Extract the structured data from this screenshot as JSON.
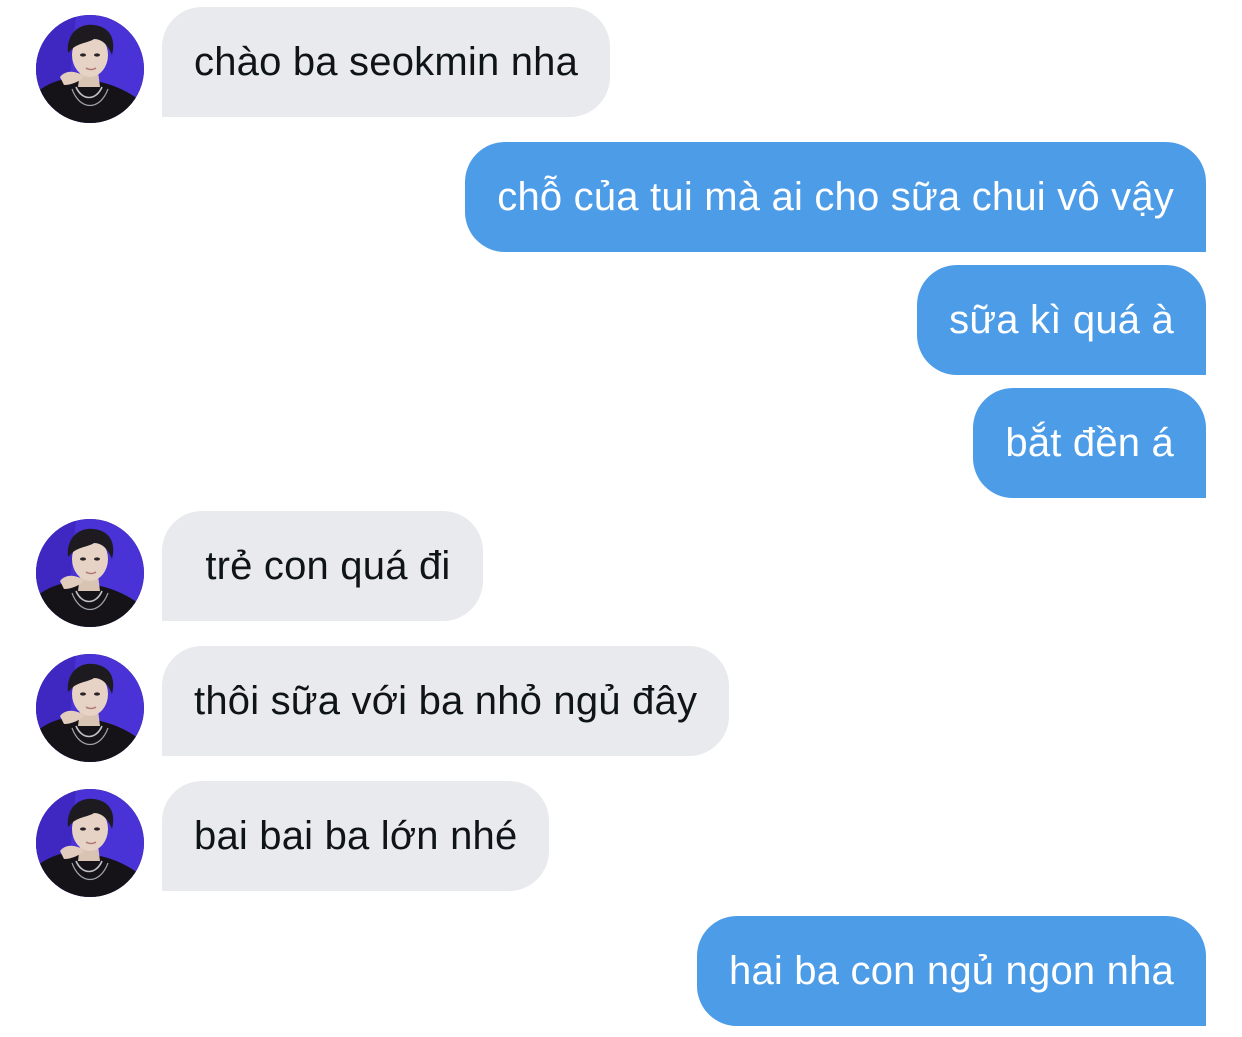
{
  "conversation": {
    "messages": [
      {
        "direction": "received",
        "text": "chào ba seokmin nha"
      },
      {
        "direction": "sent",
        "text": "chỗ của tui mà ai cho sữa chui vô vậy"
      },
      {
        "direction": "sent",
        "text": "sữa kì quá à"
      },
      {
        "direction": "sent",
        "text": "bắt đền á"
      },
      {
        "direction": "received",
        "text": " trẻ con quá đi"
      },
      {
        "direction": "received",
        "text": "thôi sữa với ba nhỏ ngủ đây"
      },
      {
        "direction": "received",
        "text": "bai bai ba lớn nhé"
      },
      {
        "direction": "sent",
        "text": "hai ba con ngủ ngon nha"
      }
    ]
  },
  "theme": {
    "sent_bubble_color": "#4d9ce8",
    "received_bubble_color": "#e8eaee",
    "avatar_backdrop_color": "#4a33d6"
  }
}
